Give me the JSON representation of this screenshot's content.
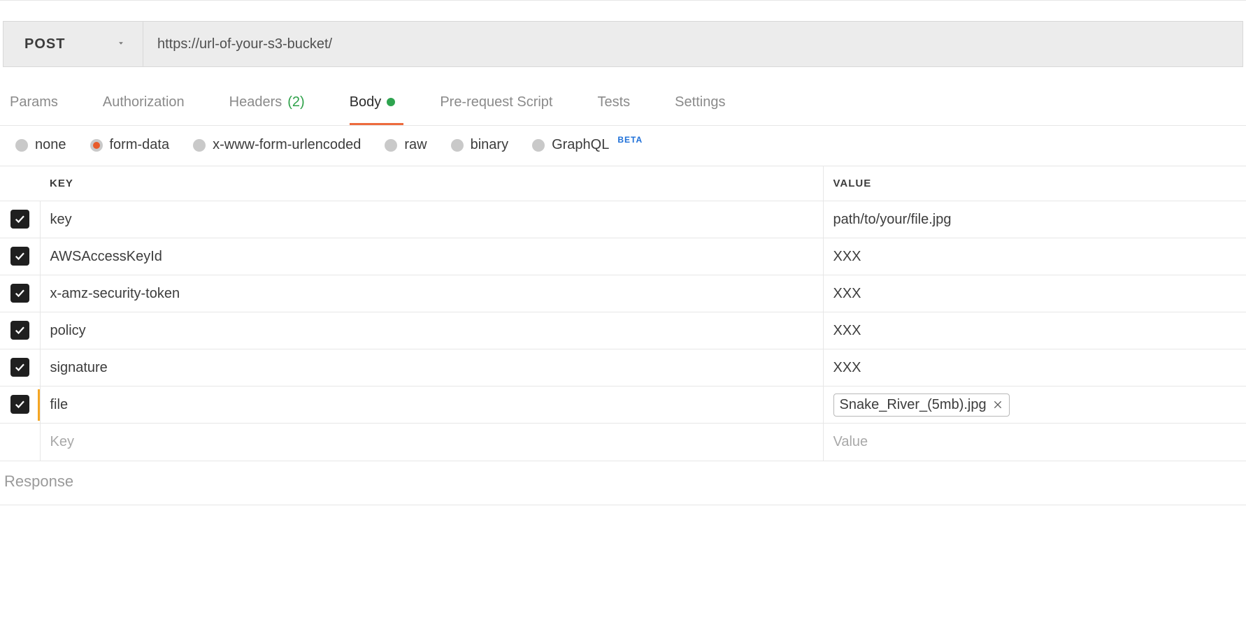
{
  "request": {
    "method": "POST",
    "url": "https://url-of-your-s3-bucket/"
  },
  "tabs": {
    "params": "Params",
    "authorization": "Authorization",
    "headers_label": "Headers",
    "headers_count": "(2)",
    "body": "Body",
    "prerequest": "Pre-request Script",
    "tests": "Tests",
    "settings": "Settings"
  },
  "body_types": {
    "none": "none",
    "form_data": "form-data",
    "xwww": "x-www-form-urlencoded",
    "raw": "raw",
    "binary": "binary",
    "graphql": "GraphQL",
    "beta": "BETA"
  },
  "table": {
    "header_key": "KEY",
    "header_value": "VALUE",
    "rows": [
      {
        "key": "key",
        "value": "path/to/your/file.jpg"
      },
      {
        "key": "AWSAccessKeyId",
        "value": "XXX"
      },
      {
        "key": "x-amz-security-token",
        "value": "XXX"
      },
      {
        "key": "policy",
        "value": "XXX"
      },
      {
        "key": "signature",
        "value": "XXX"
      },
      {
        "key": "file",
        "file": "Snake_River_(5mb).jpg"
      }
    ],
    "key_placeholder": "Key",
    "value_placeholder": "Value"
  },
  "response_label": "Response"
}
